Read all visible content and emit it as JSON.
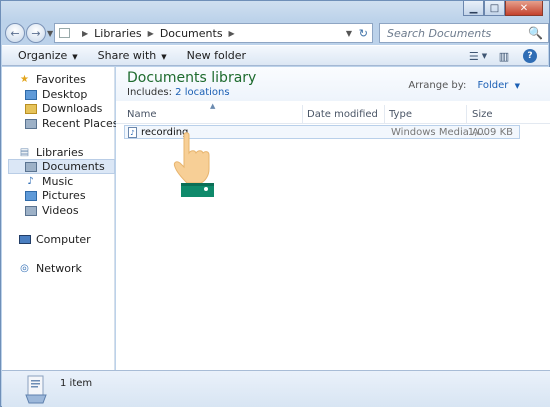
{
  "window": {
    "minimize_glyph": "▁",
    "maximize_glyph": "□",
    "close_glyph": "✕"
  },
  "nav": {
    "back_glyph": "←",
    "forward_glyph": "→",
    "dropdown_glyph": "▼"
  },
  "address": {
    "crumbs": [
      "Libraries",
      "Documents"
    ],
    "separator": "▶",
    "dropdown_glyph": "▼",
    "refresh_glyph": "↻"
  },
  "search": {
    "placeholder": "Search Documents",
    "icon_glyph": "🔍"
  },
  "toolbar": {
    "organize_label": "Organize",
    "share_label": "Share with",
    "new_folder_label": "New folder",
    "caret": "▼",
    "view_glyph": "☰",
    "view_caret": "▼",
    "preview_glyph": "▥",
    "help_glyph": "?"
  },
  "sidebar": {
    "favorites": {
      "label": "Favorites",
      "icon": "star-icon"
    },
    "favorites_items": [
      {
        "label": "Desktop",
        "icon": "desktop-folder-icon"
      },
      {
        "label": "Downloads",
        "icon": "downloads-folder-icon"
      },
      {
        "label": "Recent Places",
        "icon": "recent-places-icon"
      }
    ],
    "libraries": {
      "label": "Libraries",
      "icon": "libraries-icon"
    },
    "libraries_items": [
      {
        "label": "Documents",
        "icon": "documents-icon",
        "selected": true
      },
      {
        "label": "Music",
        "icon": "music-icon"
      },
      {
        "label": "Pictures",
        "icon": "pictures-icon"
      },
      {
        "label": "Videos",
        "icon": "videos-icon"
      }
    ],
    "computer": {
      "label": "Computer",
      "icon": "computer-icon"
    },
    "network": {
      "label": "Network",
      "icon": "network-icon"
    }
  },
  "library": {
    "title": "Documents library",
    "includes_label": "Includes:",
    "includes_link": "2 locations",
    "arrange_label": "Arrange by:",
    "arrange_value": "Folder",
    "arrange_caret": "▼"
  },
  "columns": {
    "name": "Name",
    "date": "Date modified",
    "type": "Type",
    "size": "Size",
    "sort_glyph": "▲"
  },
  "files": [
    {
      "name": "recording",
      "date": "",
      "type": "Windows Media A...",
      "size": "1,009 KB",
      "icon": "audio-file-icon"
    }
  ],
  "status": {
    "text": "1 item"
  },
  "colors": {
    "title_green": "#1e6b2e",
    "link_blue": "#1b5fb4",
    "hand_cuff": "#0f8a6b",
    "hand_skin": "#f7cf96"
  }
}
